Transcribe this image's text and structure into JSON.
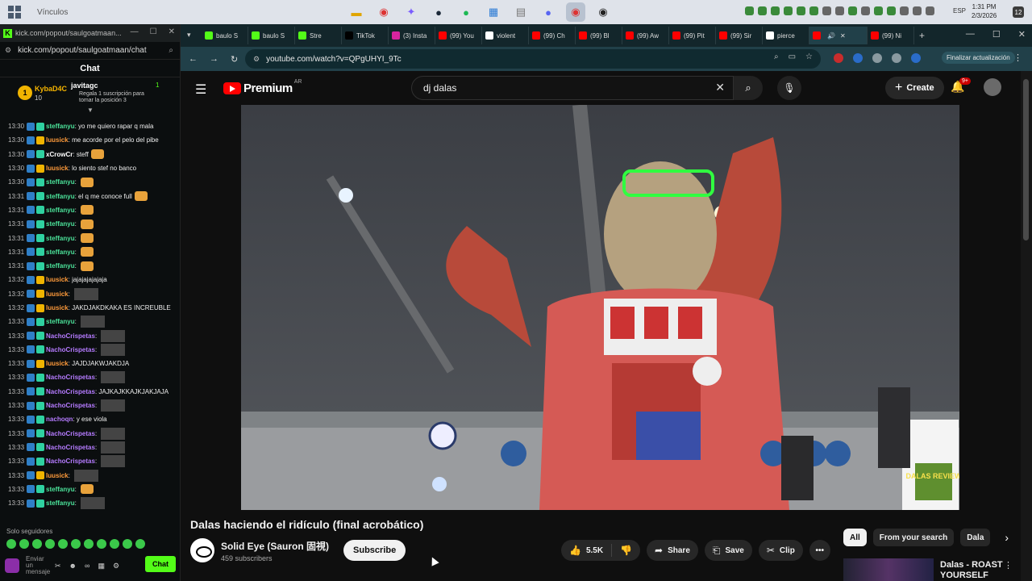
{
  "taskbar": {
    "links_label": "Vínculos",
    "lang": "ESP",
    "time": "1:31 PM",
    "date": "2/3/2026",
    "notif_count": "12"
  },
  "kick": {
    "window_title": "kick.com/popout/saulgoatmaan...",
    "url": "kick.com/popout/saulgoatmaan/chat",
    "chat_header": "Chat",
    "gifter": {
      "rank": "1",
      "name": "KybaD4C",
      "count": "10",
      "top_name": "javitagc",
      "top_count": "1",
      "top_desc": "Regala 1 suscripción para tomar la posición 3"
    },
    "messages": [
      {
        "time": "13:30",
        "user": "steffanyu",
        "color": "#4be39a",
        "text": "yo me quiero rapar q mala",
        "media": ""
      },
      {
        "time": "13:30",
        "user": "luusick",
        "color": "#ff9b3b",
        "text": "me acorde por el pelo del pibe",
        "media": ""
      },
      {
        "time": "13:30",
        "user": "xCrowCr",
        "color": "#ffffff",
        "text": "steff",
        "media": "emote"
      },
      {
        "time": "13:30",
        "user": "luusick",
        "color": "#ff9b3b",
        "text": "lo siento stef no banco",
        "media": ""
      },
      {
        "time": "13:30",
        "user": "steffanyu",
        "color": "#4be39a",
        "text": "",
        "media": "emote"
      },
      {
        "time": "13:31",
        "user": "steffanyu",
        "color": "#4be39a",
        "text": "el q me conoce full",
        "media": "emote"
      },
      {
        "time": "13:31",
        "user": "steffanyu",
        "color": "#4be39a",
        "text": "",
        "media": "emote"
      },
      {
        "time": "13:31",
        "user": "steffanyu",
        "color": "#4be39a",
        "text": "",
        "media": "emote"
      },
      {
        "time": "13:31",
        "user": "steffanyu",
        "color": "#4be39a",
        "text": "",
        "media": "emote"
      },
      {
        "time": "13:31",
        "user": "steffanyu",
        "color": "#4be39a",
        "text": "",
        "media": "emote"
      },
      {
        "time": "13:31",
        "user": "steffanyu",
        "color": "#4be39a",
        "text": "",
        "media": "emote"
      },
      {
        "time": "13:32",
        "user": "luusick",
        "color": "#ff9b3b",
        "text": "jajajajajajaja",
        "media": ""
      },
      {
        "time": "13:32",
        "user": "luusick",
        "color": "#ff9b3b",
        "text": "",
        "media": "img"
      },
      {
        "time": "13:32",
        "user": "luusick",
        "color": "#ff9b3b",
        "text": "JAKDJAKDKAKA ES INCREUBLE",
        "media": ""
      },
      {
        "time": "13:33",
        "user": "steffanyu",
        "color": "#4be39a",
        "text": "",
        "media": "img"
      },
      {
        "time": "13:33",
        "user": "NachoCrispetas",
        "color": "#b57bff",
        "text": "",
        "media": "img"
      },
      {
        "time": "13:33",
        "user": "NachoCrispetas",
        "color": "#b57bff",
        "text": "",
        "media": "img"
      },
      {
        "time": "13:33",
        "user": "luusick",
        "color": "#ff9b3b",
        "text": "JAJDJAKWJAKDJA",
        "media": ""
      },
      {
        "time": "13:33",
        "user": "NachoCrispetas",
        "color": "#b57bff",
        "text": "",
        "media": "img"
      },
      {
        "time": "13:33",
        "user": "NachoCrispetas",
        "color": "#b57bff",
        "text": "JAJKAJKKAJKJAKJAJA",
        "media": ""
      },
      {
        "time": "13:33",
        "user": "NachoCrispetas",
        "color": "#b57bff",
        "text": "",
        "media": "img"
      },
      {
        "time": "13:33",
        "user": "nachoqn",
        "color": "#b57bff",
        "text": "y ese viola",
        "media": ""
      },
      {
        "time": "13:33",
        "user": "NachoCrispetas",
        "color": "#b57bff",
        "text": "",
        "media": "img"
      },
      {
        "time": "13:33",
        "user": "NachoCrispetas",
        "color": "#b57bff",
        "text": "",
        "media": "img"
      },
      {
        "time": "13:33",
        "user": "NachoCrispetas",
        "color": "#b57bff",
        "text": "",
        "media": "img"
      },
      {
        "time": "13:33",
        "user": "luusick",
        "color": "#ff9b3b",
        "text": "",
        "media": "img"
      },
      {
        "time": "13:33",
        "user": "steffanyu",
        "color": "#4be39a",
        "text": "",
        "media": "emote"
      },
      {
        "time": "13:33",
        "user": "steffanyu",
        "color": "#4be39a",
        "text": "",
        "media": "img"
      }
    ],
    "followers_label": "Solo seguidores",
    "composer_placeholder": "Enviar un mensaje",
    "send_label": "Chat"
  },
  "tabs": [
    {
      "label": "baulo S",
      "fav": "#53fc18"
    },
    {
      "label": "baulo S",
      "fav": "#53fc18"
    },
    {
      "label": "Stre",
      "fav": "#53fc18"
    },
    {
      "label": "TikTok",
      "fav": "#000000"
    },
    {
      "label": "(3) Insta",
      "fav": "#d6249f"
    },
    {
      "label": "(99) You",
      "fav": "#ff0000"
    },
    {
      "label": "violent",
      "fav": "#ffffff"
    },
    {
      "label": "(99) Ch",
      "fav": "#ff0000"
    },
    {
      "label": "(99) Bl",
      "fav": "#ff0000"
    },
    {
      "label": "(99) Aw",
      "fav": "#ff0000"
    },
    {
      "label": "(99) Pit",
      "fav": "#ff0000"
    },
    {
      "label": "(99) Sir",
      "fav": "#ff0000"
    },
    {
      "label": "pierce",
      "fav": "#ffffff"
    },
    {
      "label": "",
      "fav": "#ff0000",
      "active": true
    },
    {
      "label": "(99) Ni",
      "fav": "#ff0000"
    }
  ],
  "omnibox": {
    "url": "youtube.com/watch?v=QPgUHYI_9Tc",
    "update_label": "Finalizar actualización"
  },
  "youtube": {
    "logo": "Premium",
    "country": "AR",
    "search_value": "dj dalas",
    "create_label": "Create",
    "notif_badge": "9+",
    "video_title": "Dalas haciendo el ridículo (final acrobático)",
    "channel_name": "Solid Eye (Sauron 固視)",
    "subscribers": "459 subscribers",
    "subscribe_label": "Subscribe",
    "likes": "5.5K",
    "share_label": "Share",
    "save_label": "Save",
    "clip_label": "Clip",
    "chips": [
      "All",
      "From your search",
      "Dala"
    ],
    "rec_title": "Dalas - ROAST YOURSELF",
    "watermark": "DALAS REVIEW"
  }
}
